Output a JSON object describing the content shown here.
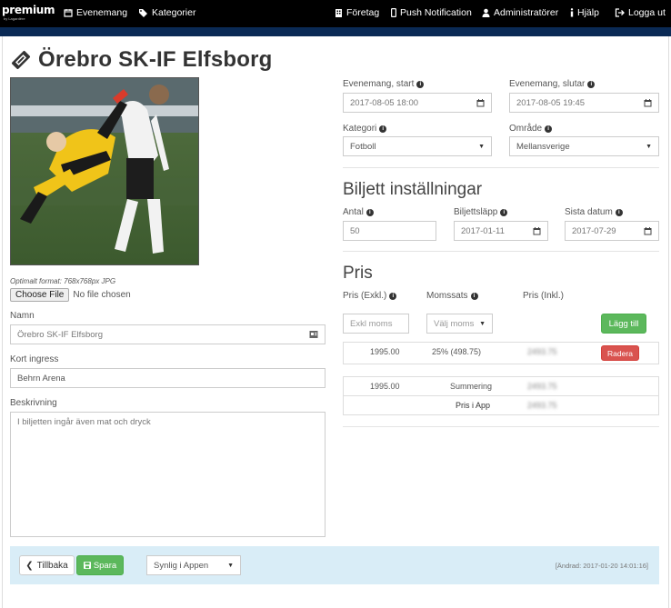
{
  "nav": {
    "brand": "premium",
    "brand_sub": "by Lagardère",
    "left": [
      {
        "label": "Evenemang",
        "icon": "calendar-icon"
      },
      {
        "label": "Kategorier",
        "icon": "tags-icon"
      }
    ],
    "right": [
      {
        "label": "Företag",
        "icon": "building-icon"
      },
      {
        "label": "Push Notification",
        "icon": "phone-icon"
      },
      {
        "label": "Administratörer",
        "icon": "user-icon"
      },
      {
        "label": "Hjälp",
        "icon": "info-icon"
      },
      {
        "label": "Logga ut",
        "icon": "logout-icon"
      }
    ]
  },
  "page": {
    "title": "Örebro SK-IF Elfsborg",
    "image_hint": "Optimalt format: 768x768px JPG",
    "file_button": "Choose File",
    "file_status": "No file chosen"
  },
  "form": {
    "namn_label": "Namn",
    "namn_value": "Örebro SK-IF Elfsborg",
    "ingress_label": "Kort ingress",
    "ingress_value": "Behrn Arena",
    "beskrivning_label": "Beskrivning",
    "beskrivning_value": "I biljetten ingår även mat och dryck",
    "start_label": "Evenemang, start",
    "start_value": "2017-08-05 18:00",
    "end_label": "Evenemang, slutar",
    "end_value": "2017-08-05 19:45",
    "kategori_label": "Kategori",
    "kategori_value": "Fotboll",
    "omrade_label": "Område",
    "omrade_value": "Mellansverige"
  },
  "tickets": {
    "heading": "Biljett inställningar",
    "antal_label": "Antal",
    "antal_value": "50",
    "release_label": "Biljettsläpp",
    "release_value": "2017-01-11",
    "last_label": "Sista datum",
    "last_value": "2017-07-29"
  },
  "pris": {
    "heading": "Pris",
    "col_excl": "Pris (Exkl.)",
    "col_moms": "Momssats",
    "col_incl": "Pris (Inkl.)",
    "excl_placeholder": "Exkl moms",
    "moms_placeholder": "Välj moms",
    "add_button": "Lägg till",
    "row": {
      "excl": "1995.00",
      "moms": "25% (498.75)",
      "incl": "2493.75",
      "delete": "Radera"
    },
    "summary": {
      "excl": "1995.00",
      "label": "Summering",
      "incl": "2493.75"
    },
    "app_label": "Pris i App",
    "app_value": "2493.75"
  },
  "footer": {
    "back": "Tillbaka",
    "save": "Spara",
    "visibility": "Synlig i Appen",
    "stamp": "[Ändrad: 2017-01-20 14:01:16]"
  }
}
